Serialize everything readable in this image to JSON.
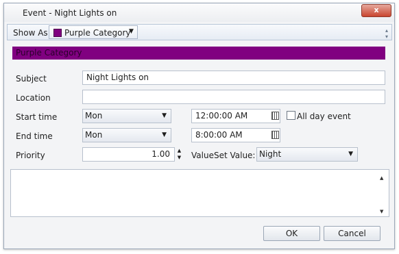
{
  "window": {
    "title": "Event - Night Lights on",
    "close_glyph": "x"
  },
  "toolbar": {
    "show_as_label": "Show As",
    "show_as_value": "Purple Category",
    "show_as_color": "#800080"
  },
  "category_bar": {
    "label": "Purple Category",
    "color": "#800080"
  },
  "form": {
    "subject_label": "Subject",
    "subject_value": "Night Lights on",
    "location_label": "Location",
    "location_value": "",
    "start_label": "Start time",
    "start_day": "Mon",
    "start_time": "12:00:00 AM",
    "all_day_label": "All day event",
    "all_day_checked": false,
    "end_label": "End time",
    "end_day": "Mon",
    "end_time": "8:00:00 AM",
    "priority_label": "Priority",
    "priority_value": "1.00",
    "valueset_label": "ValueSet Value:",
    "valueset_value": "Night"
  },
  "notes": {
    "value": ""
  },
  "buttons": {
    "ok": "OK",
    "cancel": "Cancel"
  }
}
